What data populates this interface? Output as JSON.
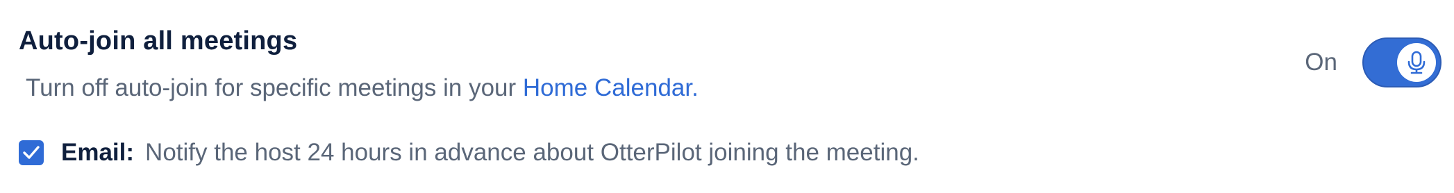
{
  "setting": {
    "title": "Auto-join all meetings",
    "subtitle_prefix": "Turn off auto-join for specific meetings in your ",
    "subtitle_link": "Home Calendar.",
    "toggle_state_label": "On",
    "toggle_on": true,
    "toggle_icon": "microphone-icon"
  },
  "email_option": {
    "checked": true,
    "label": "Email:",
    "description": "Notify the host 24 hours in advance about OtterPilot joining the meeting."
  },
  "colors": {
    "accent": "#2f6bd6",
    "title": "#0f1f3d",
    "muted": "#5a6678"
  }
}
